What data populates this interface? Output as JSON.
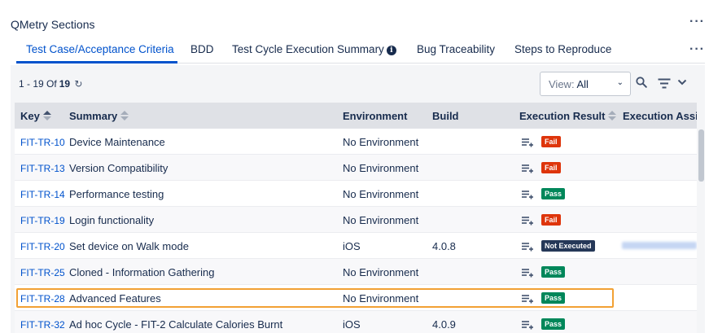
{
  "panel": {
    "title": "QMetry Sections",
    "more": "···"
  },
  "tabs": [
    {
      "label": "Test Case/Acceptance Criteria",
      "active": true
    },
    {
      "label": "BDD"
    },
    {
      "label": "Test Cycle Execution Summary",
      "has_info_icon": true
    },
    {
      "label": "Bug Traceability"
    },
    {
      "label": "Steps to Reproduce"
    }
  ],
  "tabs_more": "···",
  "toolbar": {
    "range": "1 - 19 Of",
    "total": "19",
    "view_label": "View:",
    "view_value": "All",
    "icons": [
      "refresh-icon",
      "search-icon",
      "filter-icon",
      "chevron-down-icon"
    ]
  },
  "table": {
    "columns": [
      "Key",
      "Summary",
      "Environment",
      "Build",
      "Execution Result",
      "Execution Assi"
    ],
    "rows": [
      {
        "key": "FIT-TR-10",
        "summary": "Device Maintenance",
        "environment": "No Environment",
        "build": "",
        "result": "Fail"
      },
      {
        "key": "FIT-TR-13",
        "summary": "Version Compatibility",
        "environment": "No Environment",
        "build": "",
        "result": "Fail"
      },
      {
        "key": "FIT-TR-14",
        "summary": "Performance testing",
        "environment": "No Environment",
        "build": "",
        "result": "Pass"
      },
      {
        "key": "FIT-TR-19",
        "summary": "Login functionality",
        "environment": "No Environment",
        "build": "",
        "result": "Fail"
      },
      {
        "key": "FIT-TR-20",
        "summary": "Set device on Walk mode",
        "environment": "iOS",
        "build": "4.0.8",
        "result": "Not Executed"
      },
      {
        "key": "FIT-TR-25",
        "summary": "Cloned - Information Gathering",
        "environment": "No Environment",
        "build": "",
        "result": "Pass"
      },
      {
        "key": "FIT-TR-28",
        "summary": "Advanced Features",
        "environment": "No Environment",
        "build": "",
        "result": "Pass"
      },
      {
        "key": "FIT-TR-32",
        "summary": "Ad hoc Cycle - FIT-2 Calculate Calories Burnt",
        "environment": "iOS",
        "build": "4.0.9",
        "result": "Pass"
      }
    ]
  },
  "colors": {
    "accent": "#0052cc",
    "fail": "#de350b",
    "pass": "#00875a",
    "not_executed": "#253858",
    "highlight": "#f2a134"
  }
}
